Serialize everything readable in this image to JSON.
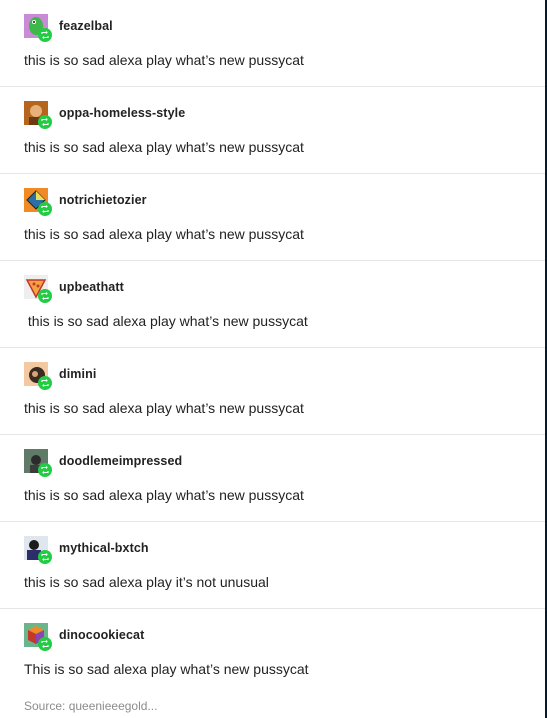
{
  "colors": {
    "page_background": "#001935",
    "card_background": "#ffffff",
    "divider": "#e6e6e6",
    "text": "#222222",
    "muted_text": "#8c8c8c",
    "reblog_badge": "#22cc44"
  },
  "reblogs": [
    {
      "username": "feazelbal",
      "text": "this is so sad alexa play what’s new pussycat",
      "avatar_icon": "green-dinosaur-avatar"
    },
    {
      "username": "oppa-homeless-style",
      "text": "this is so sad alexa play what’s new pussycat",
      "avatar_icon": "photo-avatar"
    },
    {
      "username": "notrichietozier",
      "text": "this is so sad alexa play what’s new pussycat",
      "avatar_icon": "diamond-avatar"
    },
    {
      "username": "upbeathatt",
      "text": " this is so sad alexa play what’s new pussycat",
      "avatar_icon": "pizza-slice-avatar"
    },
    {
      "username": "dimini",
      "text": "this is so sad alexa play what’s new pussycat",
      "avatar_icon": "photo-avatar"
    },
    {
      "username": "doodlemeimpressed",
      "text": "this is so sad alexa play what’s new pussycat",
      "avatar_icon": "photo-avatar"
    },
    {
      "username": "mythical-bxtch",
      "text": "this is so sad alexa play it’s not unusual",
      "avatar_icon": "photo-avatar"
    },
    {
      "username": "dinocookiecat",
      "text": "This is so sad alexa play what’s new pussycat",
      "avatar_icon": "cube-avatar"
    }
  ],
  "source": {
    "label": "Source: queenieeegold..."
  }
}
